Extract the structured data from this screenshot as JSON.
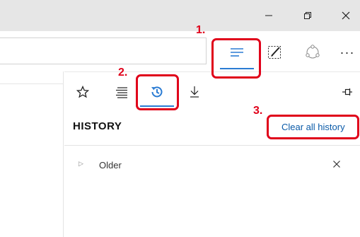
{
  "window": {
    "minimize_label": "Minimize",
    "restore_label": "Restore",
    "close_label": "Close"
  },
  "toolbar": {
    "hub_icon": "hub-icon",
    "web_note_icon": "web-note-icon",
    "share_icon": "share-icon",
    "more_label": "···"
  },
  "hub": {
    "tabs": [
      {
        "name": "favorites",
        "icon": "star-icon"
      },
      {
        "name": "reading-list",
        "icon": "reading-list-icon"
      },
      {
        "name": "history",
        "icon": "history-icon",
        "active": true
      },
      {
        "name": "downloads",
        "icon": "download-icon"
      }
    ],
    "pin_icon": "pin-icon",
    "heading": "HISTORY",
    "clear_link": "Clear all history",
    "groups": [
      {
        "label": "Older"
      }
    ]
  },
  "annotations": {
    "step1": "1.",
    "step2": "2.",
    "step3": "3."
  },
  "colors": {
    "accent": "#2b7cd3",
    "annotation": "#e0001a",
    "titlebar": "#e6e6e6",
    "link": "#0a5aa8"
  }
}
